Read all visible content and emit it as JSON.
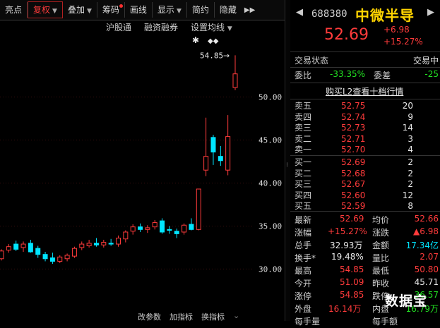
{
  "toolbar": {
    "items": [
      {
        "label": "亮点"
      },
      {
        "label": "复权",
        "active": true,
        "dropdown": true
      },
      {
        "label": "叠加",
        "dropdown": true
      },
      {
        "label": "筹码",
        "dot": true
      },
      {
        "label": "画线"
      },
      {
        "label": "显示",
        "dropdown": true
      },
      {
        "label": "简约"
      },
      {
        "label": "隐藏"
      }
    ],
    "more_icon": "double-chevron-right-icon"
  },
  "subnav": {
    "hk_connect": "沪股通",
    "margin": "融资融券",
    "ma_settings": "设置均线"
  },
  "chart_data": {
    "type": "candlestick",
    "y_ticks": [
      "50.00",
      "45.00",
      "40.00",
      "35.00",
      "30.00"
    ],
    "ylim": [
      27.0,
      55.7
    ],
    "peak_label": "54.85",
    "candles": [
      {
        "o": 31.2,
        "h": 32.3,
        "l": 31.0,
        "c": 32.1
      },
      {
        "o": 32.2,
        "h": 32.9,
        "l": 31.9,
        "c": 32.6
      },
      {
        "o": 32.9,
        "h": 33.3,
        "l": 32.1,
        "c": 32.3
      },
      {
        "o": 32.5,
        "h": 33.2,
        "l": 32.0,
        "c": 32.9
      },
      {
        "o": 33.0,
        "h": 33.4,
        "l": 31.9,
        "c": 32.0
      },
      {
        "o": 32.4,
        "h": 32.7,
        "l": 31.3,
        "c": 31.7
      },
      {
        "o": 31.7,
        "h": 32.0,
        "l": 30.9,
        "c": 31.2
      },
      {
        "o": 31.3,
        "h": 31.9,
        "l": 30.6,
        "c": 30.9
      },
      {
        "o": 30.9,
        "h": 31.6,
        "l": 30.7,
        "c": 31.4
      },
      {
        "o": 31.2,
        "h": 31.8,
        "l": 30.9,
        "c": 31.6
      },
      {
        "o": 31.5,
        "h": 32.6,
        "l": 31.3,
        "c": 32.4
      },
      {
        "o": 32.5,
        "h": 33.2,
        "l": 32.2,
        "c": 32.9
      },
      {
        "o": 32.7,
        "h": 33.4,
        "l": 32.5,
        "c": 33.0
      },
      {
        "o": 33.0,
        "h": 33.6,
        "l": 32.6,
        "c": 32.8
      },
      {
        "o": 32.8,
        "h": 33.4,
        "l": 32.5,
        "c": 33.1
      },
      {
        "o": 33.0,
        "h": 33.5,
        "l": 32.7,
        "c": 32.9
      },
      {
        "o": 32.9,
        "h": 33.9,
        "l": 32.6,
        "c": 33.6
      },
      {
        "o": 33.5,
        "h": 34.5,
        "l": 33.1,
        "c": 34.3
      },
      {
        "o": 34.4,
        "h": 35.2,
        "l": 34.0,
        "c": 34.9
      },
      {
        "o": 34.9,
        "h": 35.3,
        "l": 34.3,
        "c": 34.6
      },
      {
        "o": 34.6,
        "h": 35.1,
        "l": 34.2,
        "c": 34.8
      },
      {
        "o": 34.9,
        "h": 35.7,
        "l": 34.6,
        "c": 35.4
      },
      {
        "o": 35.6,
        "h": 35.9,
        "l": 34.1,
        "c": 34.3
      },
      {
        "o": 34.6,
        "h": 35.0,
        "l": 34.1,
        "c": 34.5
      },
      {
        "o": 34.4,
        "h": 34.7,
        "l": 33.6,
        "c": 34.1
      },
      {
        "o": 34.3,
        "h": 35.3,
        "l": 34.0,
        "c": 35.1
      },
      {
        "o": 35.2,
        "h": 35.9,
        "l": 34.5,
        "c": 34.6
      },
      {
        "o": 34.6,
        "h": 39.3,
        "l": 34.5,
        "c": 39.3
      },
      {
        "o": 41.5,
        "h": 47.6,
        "l": 40.8,
        "c": 43.1
      },
      {
        "o": 45.3,
        "h": 45.6,
        "l": 42.1,
        "c": 43.6
      },
      {
        "o": 43.1,
        "h": 44.3,
        "l": 42.0,
        "c": 42.6
      },
      {
        "o": 41.5,
        "h": 47.9,
        "l": 40.9,
        "c": 45.4
      },
      {
        "o": 51.1,
        "h": 54.85,
        "l": 50.8,
        "c": 52.69
      }
    ]
  },
  "bottom_bar": {
    "item1": "改参数",
    "item2": "加指标",
    "item3": "换指标"
  },
  "quote": {
    "code": "688380",
    "name": "中微半导",
    "last_price": "52.69",
    "change": "+6.98",
    "change_pct": "+15.27%",
    "trade_status_label": "交易状态",
    "trade_status_value": "交易中",
    "wb_label": "委比",
    "wb_value": "-33.35%",
    "wc_label": "委差",
    "wc_value": "-25",
    "l2_link": "购买L2查看十档行情"
  },
  "order_book": {
    "asks": [
      {
        "label": "卖五",
        "price": "52.75",
        "volume": "20"
      },
      {
        "label": "卖四",
        "price": "52.74",
        "volume": "9"
      },
      {
        "label": "卖三",
        "price": "52.73",
        "volume": "14"
      },
      {
        "label": "卖二",
        "price": "52.71",
        "volume": "3"
      },
      {
        "label": "卖一",
        "price": "52.70",
        "volume": "4"
      }
    ],
    "bids": [
      {
        "label": "买一",
        "price": "52.69",
        "volume": "2"
      },
      {
        "label": "买二",
        "price": "52.68",
        "volume": "2"
      },
      {
        "label": "买三",
        "price": "52.67",
        "volume": "2"
      },
      {
        "label": "买四",
        "price": "52.60",
        "volume": "12"
      },
      {
        "label": "买五",
        "price": "52.59",
        "volume": "8"
      }
    ]
  },
  "stats": {
    "latest": {
      "label": "最新",
      "value": "52.69"
    },
    "avg": {
      "label": "均价",
      "value": "52.66"
    },
    "pct": {
      "label": "涨幅",
      "value": "+15.27%"
    },
    "updown": {
      "label": "涨跌",
      "value": "▲6.98"
    },
    "volume": {
      "label": "总手",
      "value": "32.93万"
    },
    "amount": {
      "label": "金额",
      "value": "17.34亿"
    },
    "turnover": {
      "label": "换手*",
      "value": "19.48%"
    },
    "vol_ratio": {
      "label": "量比",
      "value": "2.07"
    },
    "high": {
      "label": "最高",
      "value": "54.85"
    },
    "low": {
      "label": "最低",
      "value": "50.80"
    },
    "open": {
      "label": "今开",
      "value": "51.09"
    },
    "prev_close": {
      "label": "昨收",
      "value": "45.71"
    },
    "limit_up": {
      "label": "涨停",
      "value": "54.85"
    },
    "limit_down": {
      "label": "跌停",
      "value": "36.57"
    },
    "outer": {
      "label": "外盘",
      "value": "16.14万"
    },
    "inner": {
      "label": "内盘",
      "value": "16.79万"
    },
    "cut1": {
      "label": "每手量"
    },
    "cut2": {
      "label": "每手额"
    }
  },
  "watermark": "数据宝",
  "colors": {
    "up": "#ff3b3b",
    "down": "#00e5ff",
    "name": "#ffd400"
  }
}
